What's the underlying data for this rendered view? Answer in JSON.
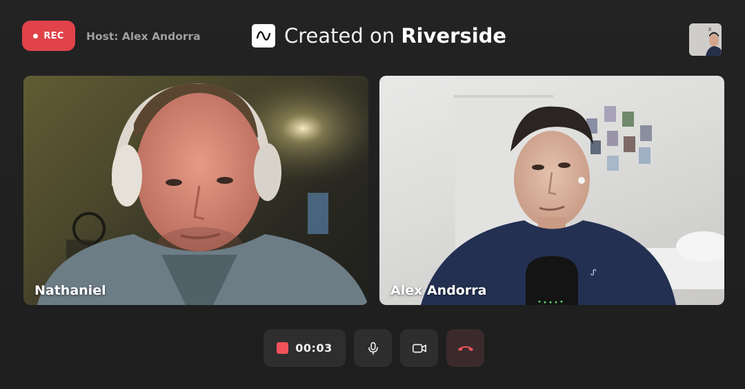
{
  "header": {
    "rec_label": "REC",
    "host_label": "Host: Alex Andorra",
    "brand_prefix": "Created on",
    "brand_name": "Riverside",
    "accent_color": "#e0434a"
  },
  "participants": [
    {
      "name": "Nathaniel"
    },
    {
      "name": "Alex Andorra"
    }
  ],
  "controls": {
    "timer": "00:03",
    "stop_icon": "stop-square-icon",
    "mic_icon": "microphone-icon",
    "camera_icon": "video-camera-icon",
    "end_call_icon": "hang-up-phone-icon",
    "end_call_color": "#e0434a"
  }
}
